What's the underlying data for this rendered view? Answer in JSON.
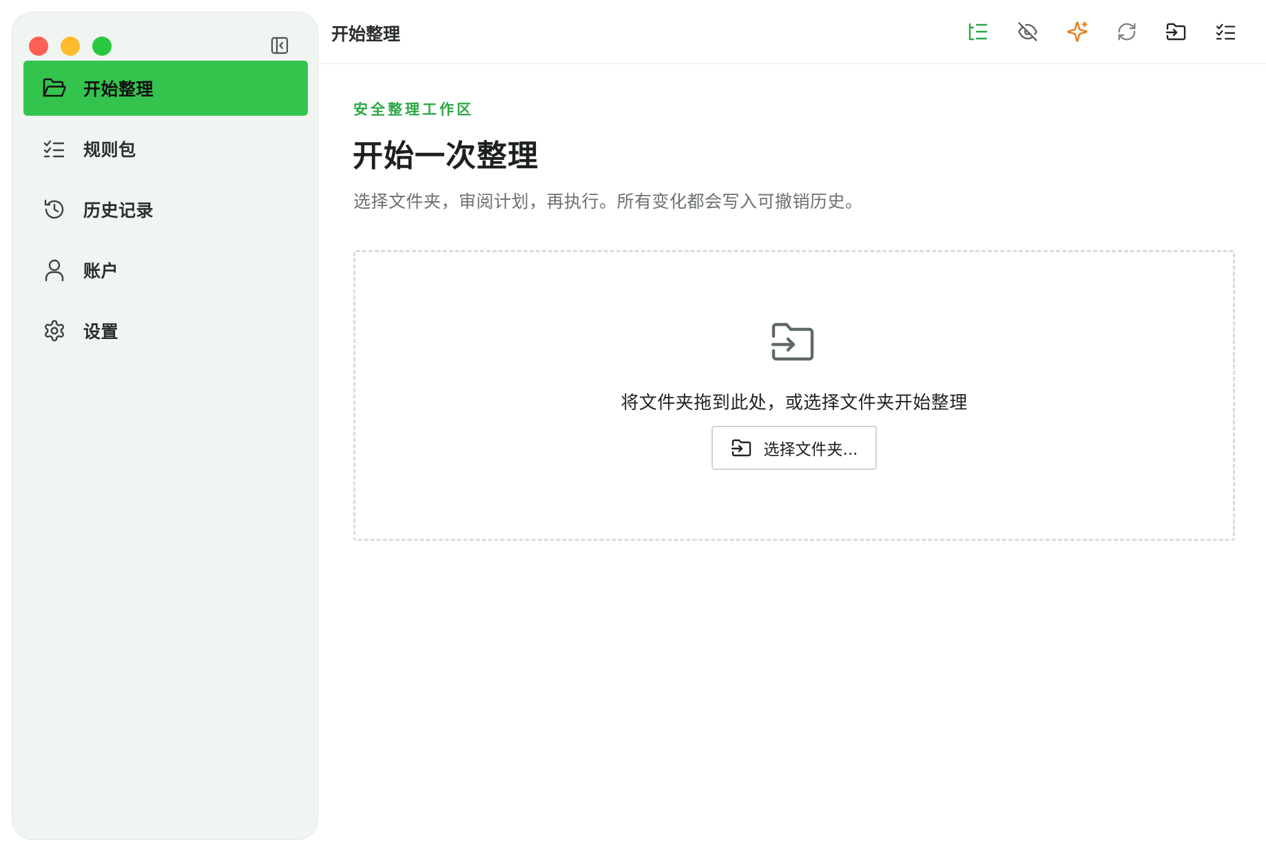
{
  "window": {
    "traffic_lights": [
      "close",
      "minimize",
      "zoom"
    ]
  },
  "sidebar": {
    "collapse_icon": "sidebar-collapse-icon",
    "items": [
      {
        "label": "开始整理",
        "icon": "folder-open-icon",
        "active": true
      },
      {
        "label": "规则包",
        "icon": "checklist-icon",
        "active": false
      },
      {
        "label": "历史记录",
        "icon": "history-icon",
        "active": false
      },
      {
        "label": "账户",
        "icon": "user-icon",
        "active": false
      },
      {
        "label": "设置",
        "icon": "gear-icon",
        "active": false
      }
    ]
  },
  "header": {
    "title": "开始整理",
    "tools": [
      {
        "name": "tree-list-icon",
        "color": "#2aa744"
      },
      {
        "name": "eye-off-icon",
        "color": "#5a605c"
      },
      {
        "name": "sparkles-icon",
        "color": "#e5821e"
      },
      {
        "name": "refresh-icon",
        "color": "#7d837f"
      },
      {
        "name": "folder-import-icon",
        "color": "#1f2320"
      },
      {
        "name": "checklist-icon",
        "color": "#1f2320"
      }
    ]
  },
  "main": {
    "eyebrow": "安全整理工作区",
    "title": "开始一次整理",
    "subtitle": "选择文件夹，审阅计划，再执行。所有变化都会写入可撤销历史。",
    "dropzone": {
      "icon": "folder-import-icon",
      "text": "将文件夹拖到此处，或选择文件夹开始整理",
      "button_label": "选择文件夹..."
    }
  },
  "colors": {
    "accent": "#34c44d",
    "accent_text": "#2aa744",
    "sidebar_bg": "#f1f5f2",
    "sparkle": "#e5821e"
  }
}
